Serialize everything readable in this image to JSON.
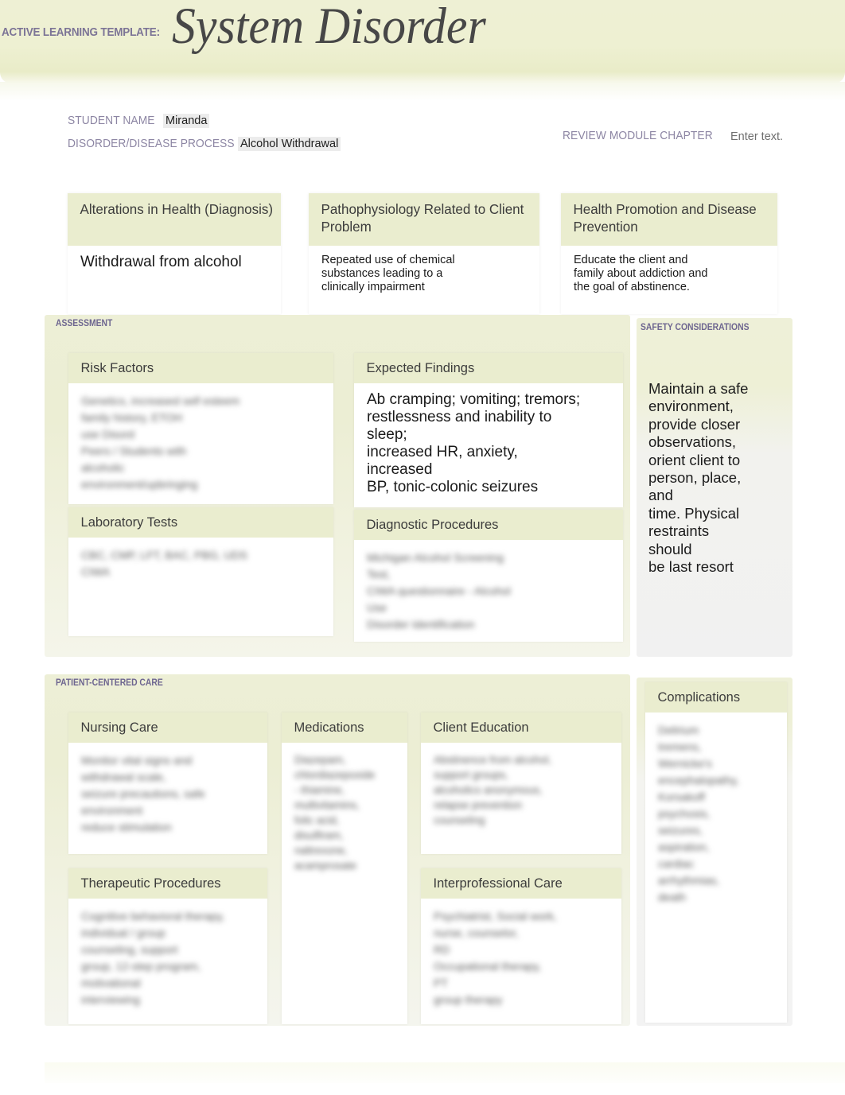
{
  "header": {
    "template_label": "ACTIVE LEARNING TEMPLATE:",
    "title": "System Disorder"
  },
  "meta": {
    "student_name_label": "STUDENT NAME",
    "student_name_value": "Miranda",
    "disorder_label": "DISORDER/DISEASE PROCESS",
    "disorder_value": "Alcohol Withdrawal",
    "review_module_label": "REVIEW MODULE CHAPTER",
    "review_module_value": "Enter text."
  },
  "top_boxes": [
    {
      "title": "Alterations in Health (Diagnosis)",
      "body": "Withdrawal from alcohol"
    },
    {
      "title": "Pathophysiology Related to Client Problem",
      "body": "Repeated use of chemical\nsubstances leading to a\nclinically impairment"
    },
    {
      "title": "Health Promotion and Disease Prevention",
      "body": "Educate the client and\nfamily about addiction and\nthe goal of abstinence."
    }
  ],
  "assessment": {
    "section_label": "ASSESSMENT",
    "risk_factors": {
      "title": "Risk Factors",
      "body": "Genetics, increased self esteem\nfamily history, ETOH\nuse Disord\nPeers / Students with\nalcoholic\nenvironment/upbringing"
    },
    "expected_findings": {
      "title": "Expected Findings",
      "body": "Ab cramping; vomiting; tremors;\nrestlessness and inability to\nsleep;\nincreased HR, anxiety,\nincreased\nBP, tonic-colonic seizures"
    },
    "laboratory_tests": {
      "title": "Laboratory Tests",
      "body": "CBC, CMP, LFT, BAC, PBG, UDS\nCIWA"
    },
    "diagnostic_procedures": {
      "title": "Diagnostic Procedures",
      "body": "Michigan Alcohol Screening\nTest,\nCIWA questionnaire - Alcohol\nUse\nDisorder Identification"
    }
  },
  "safety": {
    "section_label": "SAFETY CONSIDERATIONS",
    "body": "Maintain a safe\nenvironment,\nprovide closer\nobservations,\norient client to\nperson, place,\nand\ntime. Physical\nrestraints\nshould\nbe last resort"
  },
  "patient_centered_care": {
    "section_label": "PATIENT-CENTERED CARE",
    "nursing_care": {
      "title": "Nursing Care",
      "body": "Monitor vital signs and\nwithdrawal scale,\nseizure precautions, safe\nenvironment\nreduce stimulation"
    },
    "medications": {
      "title": "Medications",
      "body": "Diazepam,\nchlordiazepoxide\n- thiamine,\nmultivitamins,\nfolic acid,\ndisulfiram,\nnaltrexone,\nacamprosate"
    },
    "client_education": {
      "title": "Client Education",
      "body": "Abstinence from alcohol,\nsupport groups,\nalcoholics anonymous,\nrelapse prevention\ncounseling"
    },
    "therapeutic_procedures": {
      "title": "Therapeutic Procedures",
      "body": "Cognitive behavioral therapy,\nindividual / group\ncounseling, support\ngroup, 12-step program,\nmotivational\ninterviewing"
    },
    "interprofessional_care": {
      "title": "Interprofessional Care",
      "body": "Psychiatrist, Social work,\nnurse, counselor,\nRD\nOccupational therapy,\nPT\ngroup therapy"
    }
  },
  "complications": {
    "title": "Complications",
    "body": "Delirium\ntremens,\nWernicke's\nencephalopathy,\nKorsakoff\npsychosis,\nseizures,\naspiration,\ncardiac\narrhythmias,\ndeath"
  },
  "colors": {
    "band_green": "#eaedcf",
    "label_purple": "#6e6690",
    "title_gray": "#474747"
  }
}
